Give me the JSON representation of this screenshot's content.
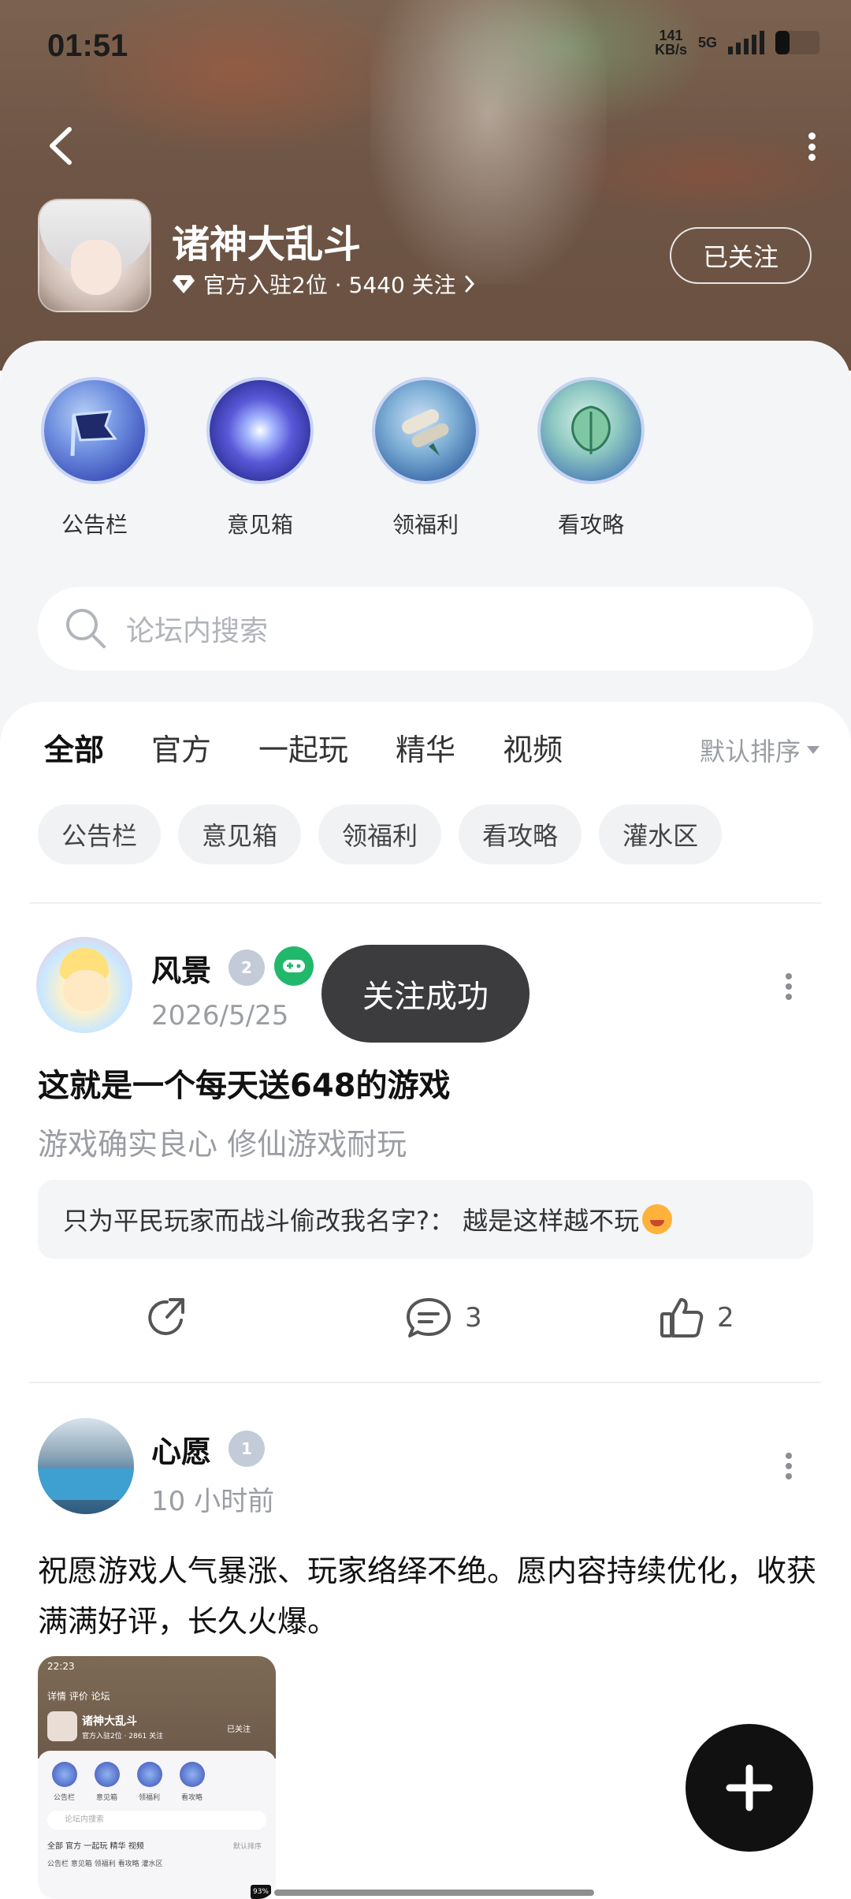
{
  "status_bar": {
    "time": "01:51",
    "net_speed": "141",
    "net_unit": "KB/s",
    "network": "5G"
  },
  "header": {
    "game_name": "诸神大乱斗",
    "meta": "官方入驻2位 · 5440 关注",
    "follow_label": "已关注"
  },
  "quick_links": [
    {
      "label": "公告栏",
      "icon": "announcement-flag-icon"
    },
    {
      "label": "意见箱",
      "icon": "galaxy-icon"
    },
    {
      "label": "领福利",
      "icon": "scroll-icon"
    },
    {
      "label": "看攻略",
      "icon": "jade-leaf-icon"
    }
  ],
  "search": {
    "placeholder": "论坛内搜索"
  },
  "tabs": [
    {
      "label": "全部",
      "active": true
    },
    {
      "label": "官方"
    },
    {
      "label": "一起玩"
    },
    {
      "label": "精华"
    },
    {
      "label": "视频"
    }
  ],
  "sort": {
    "label": "默认排序"
  },
  "chips": [
    "公告栏",
    "意见箱",
    "领福利",
    "看攻略",
    "灌水区"
  ],
  "toast": "关注成功",
  "posts": [
    {
      "user": "风景",
      "level": "2",
      "date": "2026/5/25",
      "title": "这就是一个每天送648的游戏",
      "body": "游戏确实良心 修仙游戏耐玩",
      "comment": "只为平民玩家而战斗偷改我名字?： 越是这样越不玩",
      "comments": "3",
      "likes": "2"
    },
    {
      "user": "心愿",
      "level": "1",
      "date": "10 小时前",
      "body": "祝愿游戏人气暴涨、玩家络绎不绝。愿内容持续优化，收获满满好评，长久火爆。"
    }
  ],
  "thumbnail": {
    "time": "22:23",
    "nav": "详情   评价   论坛",
    "game_name": "诸神大乱斗",
    "meta": "官方入驻2位 · 2861 关注",
    "follow": "已关注",
    "quick": [
      "公告栏",
      "意见箱",
      "领福利",
      "看攻略"
    ],
    "search": "论坛内搜索",
    "tabs": "全部    官方    一起玩    精华    视频",
    "sort": "默认排序",
    "chips": "公告栏    意见箱    领福利    看攻略    灌水区",
    "battery": "93%"
  }
}
